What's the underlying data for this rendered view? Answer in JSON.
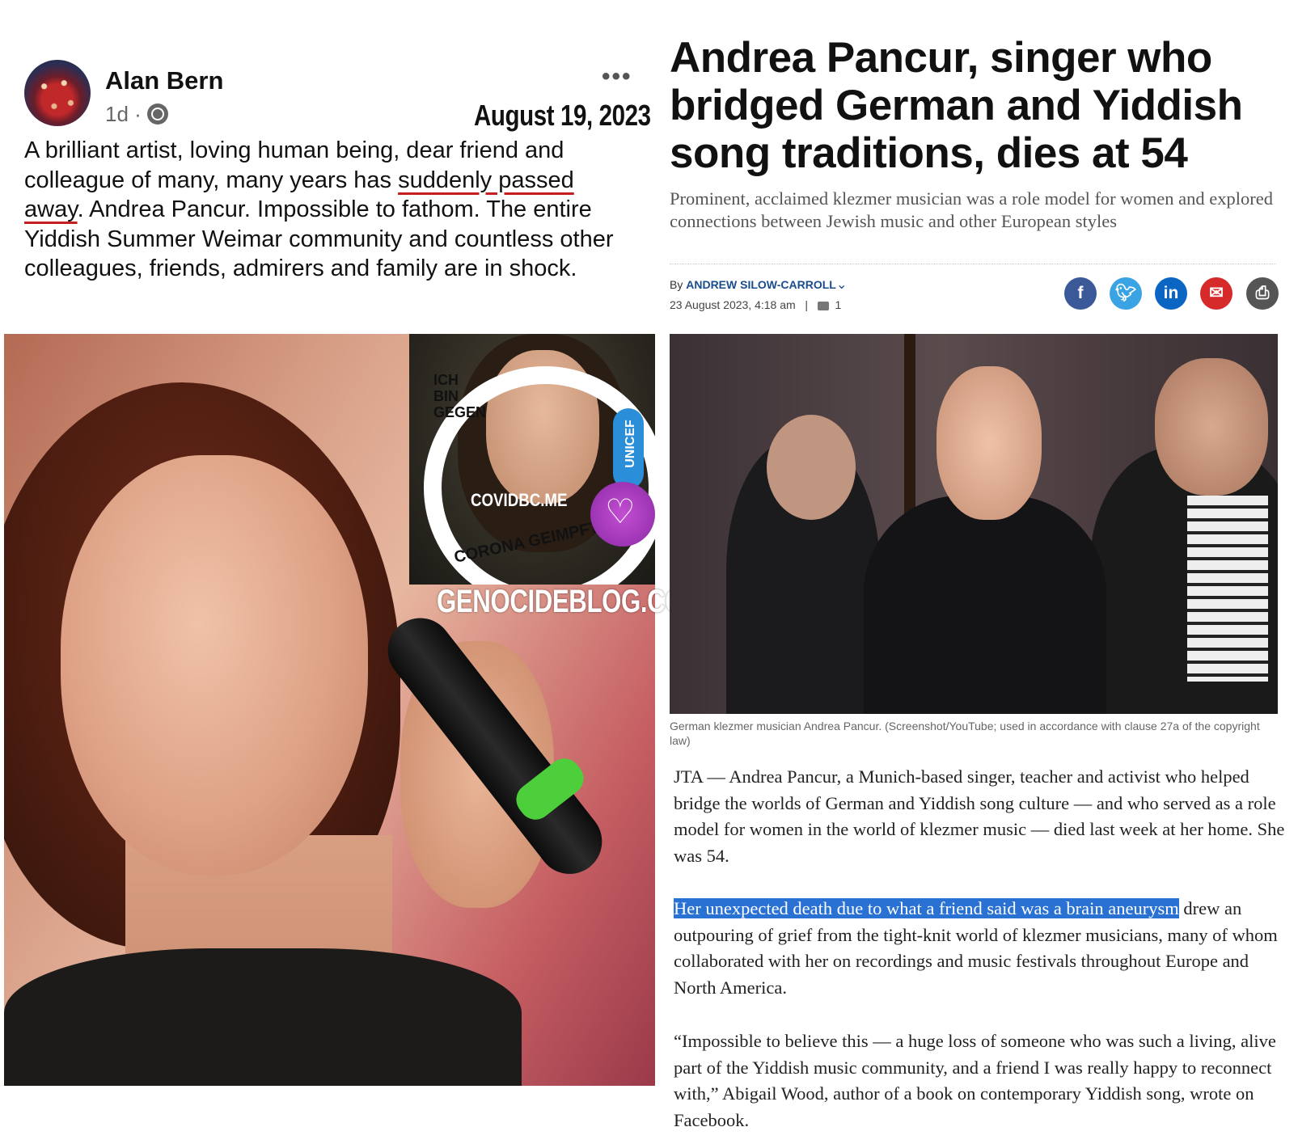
{
  "facebook_post": {
    "author": "Alan Bern",
    "time": "1d ·",
    "date_overlay": "August 19, 2023",
    "more": "•••",
    "text_before_underline": "A brilliant artist, loving human being, dear friend and colleague of many, many years has ",
    "text_underlined": "suddenly passed away",
    "text_after_underline": ". Andrea Pancur. Impossible to fathom. The entire Yiddish Summer Weimar community and countless other colleagues, friends, admirers and family are in shock."
  },
  "inset_image": {
    "ring_text": "ICH BIN GEGEN CORONA GEIMPFT",
    "ring_part_top": "ICH BIN GEGEN",
    "ring_part_bottom": "CORONA GEIMPFT",
    "badge": "UNICEF",
    "covid_text": "COVIDBC.ME",
    "watermark": "GENOCIDEBLOG.COM"
  },
  "article": {
    "title": "Andrea Pancur, singer who bridged German and Yiddish song traditions, dies at 54",
    "subtitle": "Prominent, acclaimed klezmer musician was a role model for women and explored connections between Jewish music and other European styles",
    "by_label": "By",
    "author": "ANDREW SILOW-CARROLL",
    "date": "23 August 2023, 4:18 am",
    "separator": "|",
    "comment_count": "1",
    "share_icons": [
      "facebook-icon",
      "twitter-icon",
      "linkedin-icon",
      "email-icon",
      "print-icon"
    ],
    "caption": "German klezmer musician Andrea Pancur. (Screenshot/YouTube; used in accordance with clause 27a of the copyright law)",
    "paragraph1": "JTA — Andrea Pancur, a Munich-based singer, teacher and activist who helped bridge the worlds of German and Yiddish song culture — and who served as a role model for women in the world of klezmer music — died last week at her home. She was 54.",
    "paragraph2_highlight": "Her unexpected death due to what a friend said was a brain aneurysm",
    "paragraph2_rest": " drew an outpouring of grief from the tight-knit world of klezmer musicians, many of whom collaborated with her on recordings and music festivals throughout Europe and North America.",
    "paragraph3": "“Impossible to believe this — a huge loss of someone who was such a living, alive part of the Yiddish music community, and a friend I was really happy to reconnect with,” Abigail Wood, author of a book on contemporary Yiddish song, wrote on Facebook."
  },
  "colors": {
    "highlight": "#2a71d4",
    "underline": "#c41e1e",
    "author_link": "#1a4c8e"
  }
}
